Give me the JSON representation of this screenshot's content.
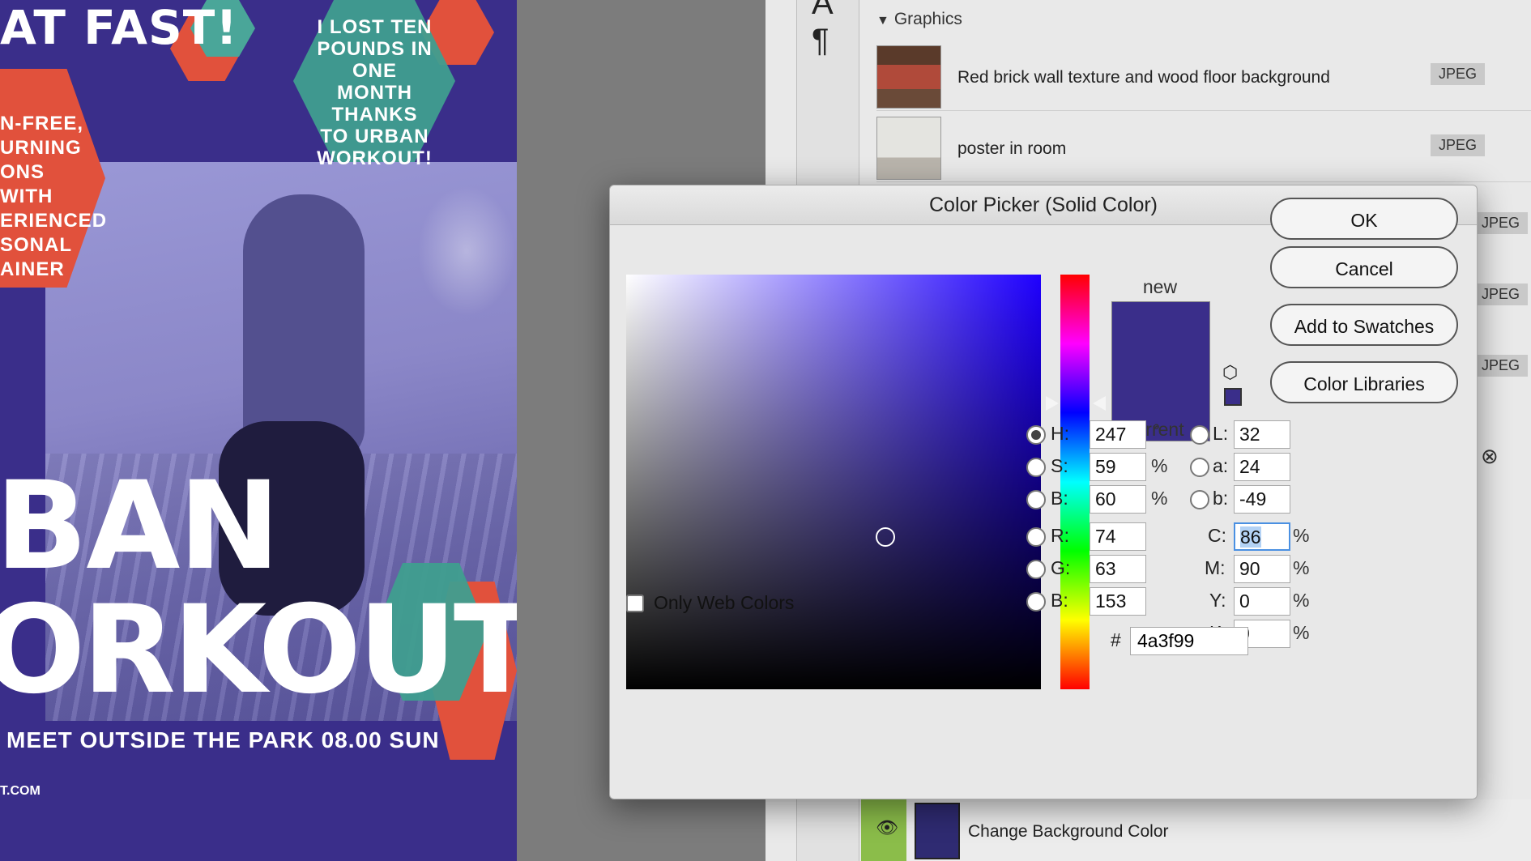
{
  "poster": {
    "headline_top": "AT FAST!",
    "bubble_text": "I LOST TEN\nPOUNDS IN ONE\nMONTH THANKS\nTO URBAN\nWORKOUT!",
    "side_text": "N-FREE,\nURNING\nONS WITH\nERIENCED\nSONAL\nAINER",
    "title_line1": "BAN",
    "title_line2": "ORKOUT",
    "meet_text": "MEET OUTSIDE THE PARK 08.00 SUN",
    "site": "T.COM"
  },
  "panel": {
    "section_title": "Graphics",
    "assets": [
      {
        "name": "Red brick wall texture and wood floor background",
        "type": "JPEG"
      },
      {
        "name": "poster in room",
        "type": "JPEG"
      }
    ],
    "extra_badges": [
      "JPEG",
      "JPEG",
      "JPEG"
    ],
    "layer_name": "Change Background Color"
  },
  "dialog": {
    "title": "Color Picker (Solid Color)",
    "label_new": "new",
    "label_current": "current",
    "buttons": {
      "ok": "OK",
      "cancel": "Cancel",
      "add_swatches": "Add to Swatches",
      "libraries": "Color Libraries"
    },
    "only_web_colors": "Only Web Colors",
    "fields": {
      "H": {
        "label": "H:",
        "value": "247",
        "unit": "°"
      },
      "S": {
        "label": "S:",
        "value": "59",
        "unit": "%"
      },
      "B": {
        "label": "B:",
        "value": "60",
        "unit": "%"
      },
      "R": {
        "label": "R:",
        "value": "74"
      },
      "G": {
        "label": "G:",
        "value": "63"
      },
      "Bl": {
        "label": "B:",
        "value": "153"
      },
      "L": {
        "label": "L:",
        "value": "32"
      },
      "a": {
        "label": "a:",
        "value": "24"
      },
      "b": {
        "label": "b:",
        "value": "-49"
      },
      "C": {
        "label": "C:",
        "value": "86",
        "unit": "%"
      },
      "M": {
        "label": "M:",
        "value": "90",
        "unit": "%"
      },
      "Y": {
        "label": "Y:",
        "value": "0",
        "unit": "%"
      },
      "K": {
        "label": "K:",
        "value": "0",
        "unit": "%"
      }
    },
    "hex_label": "#",
    "hex_value": "4a3f99",
    "colors": {
      "new": "#3a2e8a",
      "current": "#3a2e8a",
      "hue": "#1f00ff"
    }
  }
}
